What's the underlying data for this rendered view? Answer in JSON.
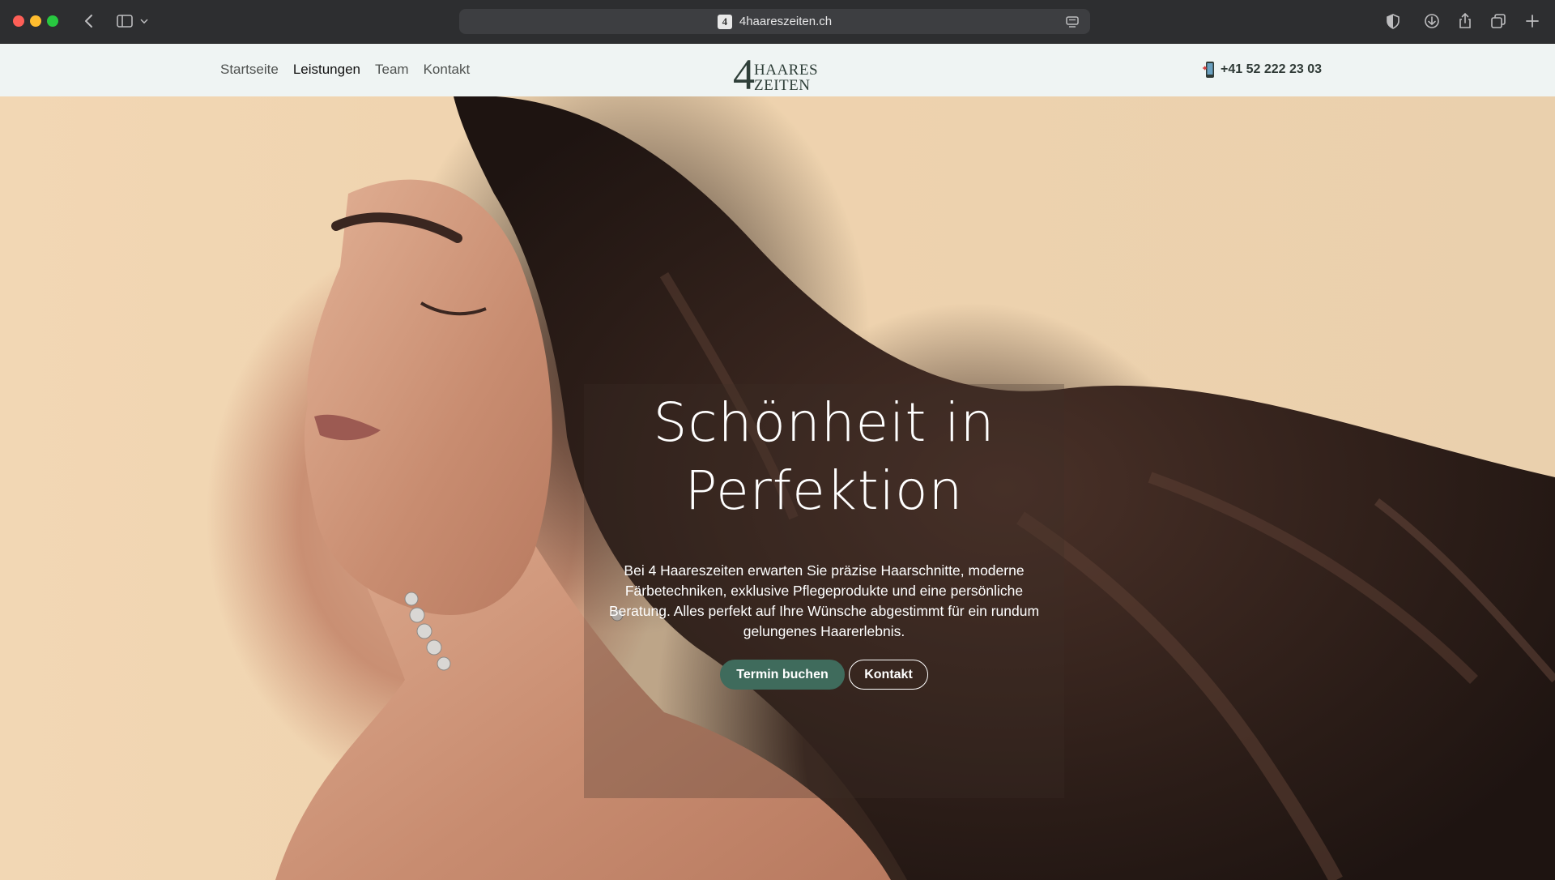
{
  "browser": {
    "url": "4haareszeiten.ch",
    "favicon_glyph": "4"
  },
  "nav": {
    "links": [
      "Startseite",
      "Leistungen",
      "Team",
      "Kontakt"
    ],
    "active": "Leistungen",
    "logo": {
      "numeral": "4",
      "line1": "HAARES",
      "line2": "ZEITEN"
    },
    "phone": "+41 52 222 23 03"
  },
  "hero": {
    "title_line1": "Schönheit in",
    "title_line2": "Perfektion",
    "text": "Bei 4 Haareszeiten erwarten Sie präzise Haarschnitte, moderne Färbetechniken, exklusive Pflegeprodukte und eine persönliche Beratung. Alles perfekt auf Ihre Wünsche abgestimmt für ein rundum gelungenes Haarerlebnis.",
    "primary_button": "Termin buchen",
    "secondary_button": "Kontakt"
  },
  "colors": {
    "nav_bg": "#eff4f3",
    "accent": "#3f6b5c",
    "hero_bg": "#efd3ae"
  }
}
